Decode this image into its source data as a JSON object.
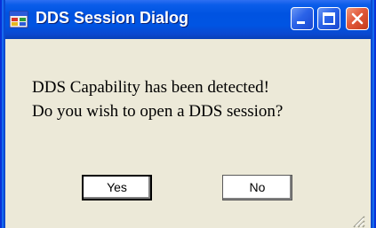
{
  "window": {
    "title": "DDS Session Dialog"
  },
  "message": {
    "line1": "DDS Capability has been detected!",
    "line2": "Do you wish to open a DDS session?"
  },
  "buttons": {
    "yes_label": "Yes",
    "no_label": "No"
  },
  "icons": {
    "app": "dialog-app-icon",
    "minimize": "minimize-icon",
    "maximize": "maximize-icon",
    "close": "close-icon",
    "resize": "resize-grip-icon"
  },
  "colors": {
    "titlebar": "#0054e3",
    "client_background": "#ece9d8",
    "close_button": "#e2593a"
  }
}
